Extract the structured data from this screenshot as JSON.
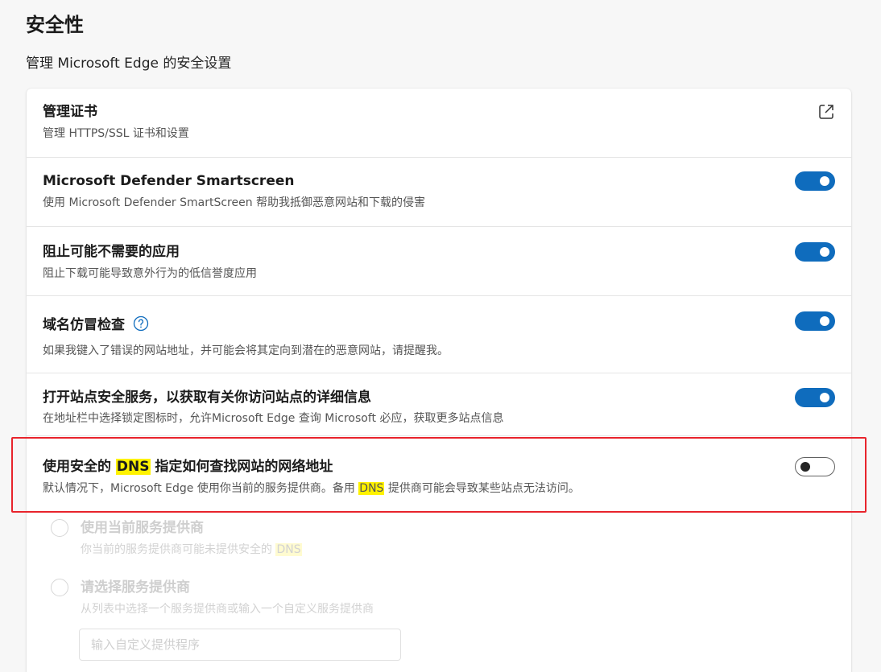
{
  "header": {
    "title": "安全性",
    "subtitle": "管理 Microsoft Edge 的安全设置"
  },
  "rows": [
    {
      "title": "管理证书",
      "desc": "管理 HTTPS/SSL 证书和设置",
      "control": "external-link-icon"
    },
    {
      "title": "Microsoft Defender Smartscreen",
      "desc": "使用 Microsoft Defender SmartScreen 帮助我抵御恶意网站和下载的侵害",
      "toggle": true
    },
    {
      "title": "阻止可能不需要的应用",
      "desc": "阻止下载可能导致意外行为的低信誉度应用",
      "toggle": true
    },
    {
      "title": "域名仿冒检查",
      "desc": "如果我键入了错误的网站地址，并可能会将其定向到潜在的恶意网站，请提醒我。",
      "toggle": true,
      "help_icon": "question-circle-icon"
    },
    {
      "title": "打开站点安全服务，以获取有关你访问站点的详细信息",
      "desc": "在地址栏中选择锁定图标时，允许Microsoft Edge 查询 Microsoft 必应，获取更多站点信息",
      "toggle": true
    },
    {
      "title_pre": "使用安全的 ",
      "title_hl": "DNS",
      "title_post": " 指定如何查找网站的网络地址",
      "desc_pre": "默认情况下，Microsoft Edge 使用你当前的服务提供商。备用 ",
      "desc_hl": "DNS",
      "desc_post": " 提供商可能会导致某些站点无法访问。",
      "toggle": false
    }
  ],
  "dns_options": [
    {
      "title": "使用当前服务提供商",
      "desc_pre": "你当前的服务提供商可能未提供安全的 ",
      "desc_hl": "DNS"
    },
    {
      "title": "请选择服务提供商",
      "desc": "从列表中选择一个服务提供商或输入一个自定义服务提供商"
    }
  ],
  "custom_provider": {
    "placeholder": "输入自定义提供程序"
  },
  "colors": {
    "accent": "#0f6cbd",
    "highlight": "#fff200",
    "annotation_border": "#e8242c"
  }
}
